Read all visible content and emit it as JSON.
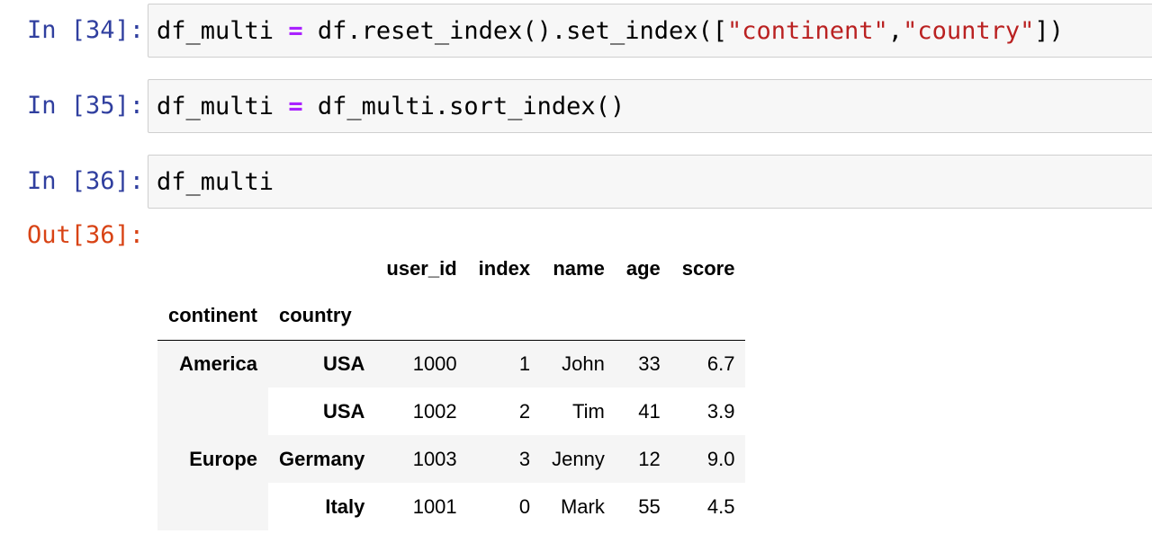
{
  "cells": [
    {
      "prompt": "In [34]:",
      "code_tokens": [
        {
          "t": "df_multi ",
          "k": "plain"
        },
        {
          "t": "=",
          "k": "op"
        },
        {
          "t": " df.reset_index().set_index([",
          "k": "plain"
        },
        {
          "t": "\"continent\"",
          "k": "str"
        },
        {
          "t": ",",
          "k": "plain"
        },
        {
          "t": "\"country\"",
          "k": "str"
        },
        {
          "t": "])",
          "k": "plain"
        }
      ]
    },
    {
      "prompt": "In [35]:",
      "code_tokens": [
        {
          "t": "df_multi ",
          "k": "plain"
        },
        {
          "t": "=",
          "k": "op"
        },
        {
          "t": " df_multi.sort_index()",
          "k": "plain"
        }
      ]
    },
    {
      "prompt": "In [36]:",
      "code_tokens": [
        {
          "t": "df_multi",
          "k": "plain"
        }
      ]
    }
  ],
  "output": {
    "prompt": "Out[36]:",
    "table": {
      "columns": [
        "user_id",
        "index",
        "name",
        "age",
        "score"
      ],
      "index_names": [
        "continent",
        "country"
      ],
      "rows": [
        {
          "continent": "America",
          "country": "USA",
          "values": [
            "1000",
            "1",
            "John",
            "33",
            "6.7"
          ]
        },
        {
          "continent": "",
          "country": "USA",
          "values": [
            "1002",
            "2",
            "Tim",
            "41",
            "3.9"
          ]
        },
        {
          "continent": "Europe",
          "country": "Germany",
          "values": [
            "1003",
            "3",
            "Jenny",
            "12",
            "9.0"
          ]
        },
        {
          "continent": "",
          "country": "Italy",
          "values": [
            "1001",
            "0",
            "Mark",
            "55",
            "4.5"
          ]
        }
      ]
    }
  },
  "colors": {
    "prompt_in": "#303f9f",
    "prompt_out": "#d84315",
    "keyword_op": "#aa22ff",
    "string": "#ba2121",
    "input_bg": "#f7f7f7",
    "stripe_bg": "#f5f5f5"
  }
}
